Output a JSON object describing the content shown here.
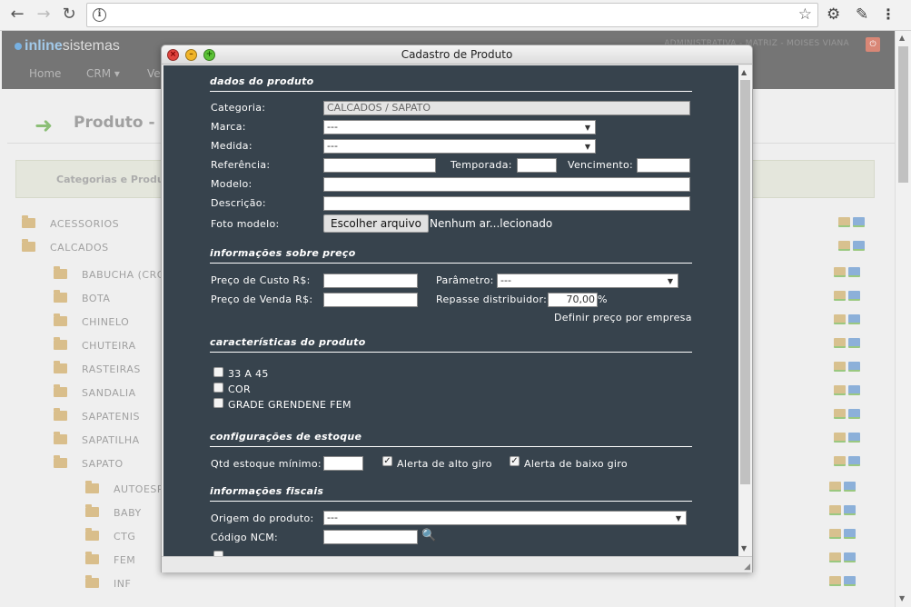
{
  "browser": {
    "back": "←",
    "forward": "→",
    "reload": "↻",
    "info": "i",
    "star": "☆",
    "settings": "⚙",
    "tool": "✎"
  },
  "app": {
    "logo_a": "inline",
    "logo_b": "sistemas",
    "menu": [
      "Home",
      "CRM ▾",
      "Ve"
    ],
    "user": "ADMINISTRATIVA - MATRIZ - MOISES VIANA",
    "logout": "⏻",
    "page_title": "Produto - C",
    "panel_title": "Categorias e Produ",
    "tree": [
      "ACESSORIOS",
      "CALCADOS",
      "BABUCHA (CRO",
      "BOTA",
      "CHINELO",
      "CHUTEIRA",
      "RASTEIRAS",
      "SANDALIA",
      "SAPATENIS",
      "SAPATILHA",
      "SAPATO",
      "AUTOESP",
      "BABY",
      "CTG",
      "FEM",
      "INF"
    ]
  },
  "dialog": {
    "title": "Cadastro de Produto",
    "close": "×",
    "min": "–",
    "max": "+",
    "sections": {
      "dados": "dados do produto",
      "preco": "informações sobre preço",
      "caract": "características do produto",
      "estoque": "configurações de estoque",
      "fiscais": "informações fiscais"
    },
    "labels": {
      "categoria": "Categoria:",
      "marca": "Marca:",
      "medida": "Medida:",
      "referencia": "Referência:",
      "temporada": "Temporada:",
      "vencimento": "Vencimento:",
      "modelo": "Modelo:",
      "descricao": "Descrição:",
      "foto": "Foto modelo:",
      "custo": "Preço de Custo R$:",
      "venda": "Preço de Venda R$:",
      "parametro": "Parâmetro:",
      "repasse": "Repasse distribuidor:",
      "pct": "%",
      "definir": "Definir preço por empresa",
      "qtd": "Qtd estoque mínimo:",
      "alto": "Alerta de alto giro",
      "baixo": "Alerta de baixo giro",
      "origem": "Origem do produto:",
      "ncm": "Código NCM:"
    },
    "values": {
      "categoria": "CALCADOS / SAPATO",
      "marca": "---",
      "medida": "---",
      "parametro": "---",
      "repasse": "70,00",
      "origem": "---",
      "file_button": "Escolher arquivo",
      "file_status": "Nenhum ar...lecionado"
    },
    "checks": [
      {
        "label": "33 A 45",
        "checked": false
      },
      {
        "label": "COR",
        "checked": false
      },
      {
        "label": "GRADE GRENDENE FEM",
        "checked": false
      }
    ],
    "check_alto": true,
    "check_baixo": true
  }
}
